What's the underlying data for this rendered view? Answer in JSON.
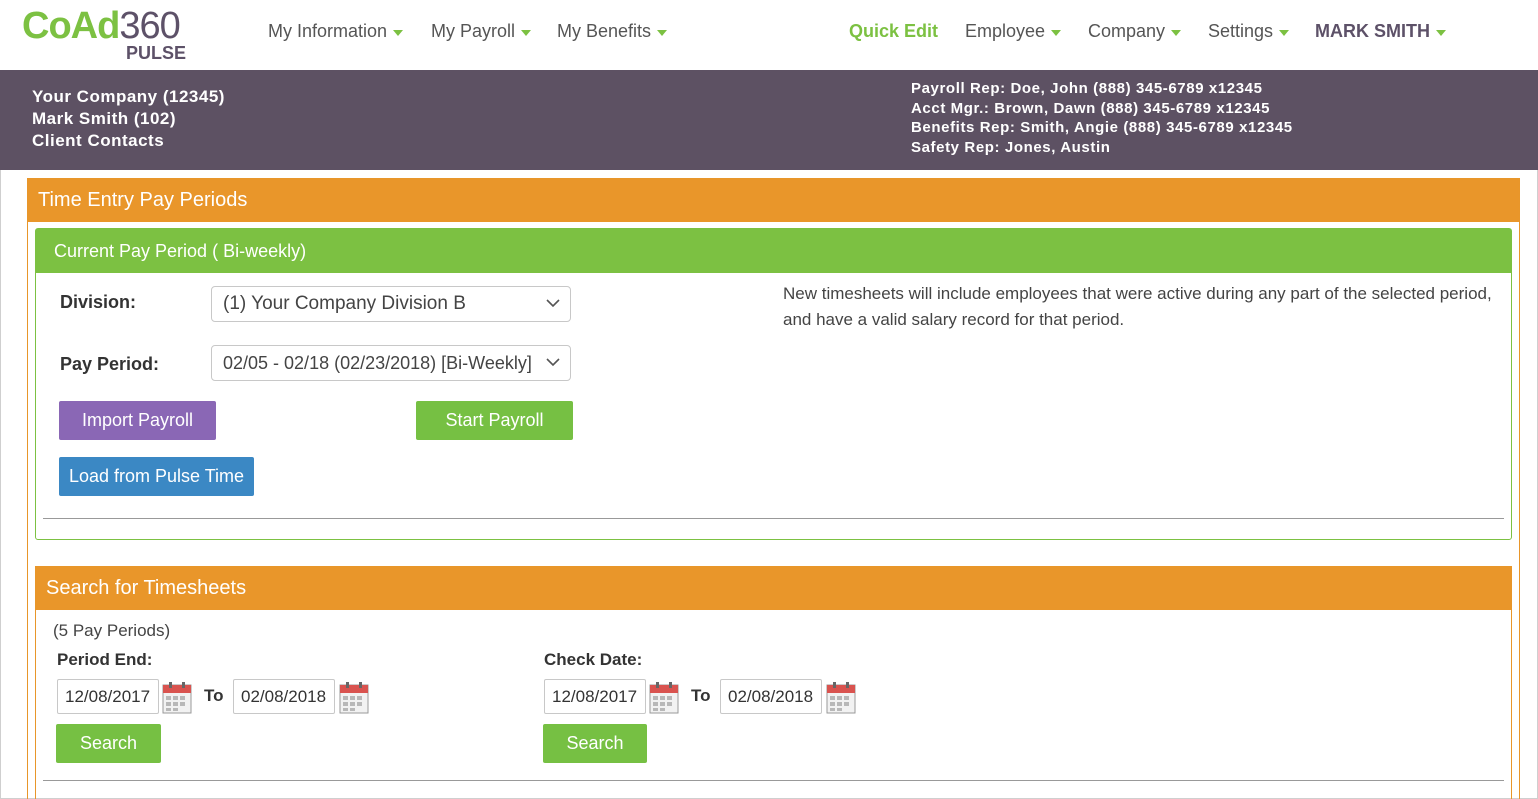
{
  "logo": {
    "brand_a": "CoAd",
    "brand_b": "360",
    "sub": "PULSE"
  },
  "nav": {
    "left": [
      {
        "label": "My Information"
      },
      {
        "label": "My Payroll"
      },
      {
        "label": "My Benefits"
      }
    ],
    "quick_edit": "Quick Edit",
    "right": [
      {
        "label": "Employee"
      },
      {
        "label": "Company"
      },
      {
        "label": "Settings"
      }
    ],
    "user": "MARK SMITH",
    "accent_color": "#7cc142"
  },
  "header": {
    "company": "Your Company (12345)",
    "user": "Mark Smith (102)",
    "contacts": "Client Contacts",
    "reps": [
      "Payroll Rep: Doe, John (888) 345-6789 x12345",
      "Acct Mgr.: Brown, Dawn (888) 345-6789 x12345",
      "Benefits Rep: Smith, Angie (888) 345-6789 x12345",
      "Safety Rep: Jones, Austin"
    ],
    "bg_color": "#5d5163"
  },
  "time_entry": {
    "title": "Time Entry Pay Periods",
    "current": {
      "title": "Current Pay Period ( Bi-weekly)",
      "division_label": "Division:",
      "division_value": "(1) Your Company Division B",
      "pay_period_label": "Pay Period:",
      "pay_period_value": "02/05 - 02/18 (02/23/2018) [Bi-Weekly]",
      "import_btn": "Import Payroll",
      "start_btn": "Start Payroll",
      "load_btn": "Load from Pulse Time",
      "info": "New timesheets will include employees that were active during any part of the selected period, and have a valid salary record for that period."
    }
  },
  "search": {
    "title": "Search for Timesheets",
    "count": "(5 Pay Periods)",
    "period_end_label": "Period End:",
    "period_end_from": "12/08/2017",
    "to_label": "To",
    "period_end_to": "02/08/2018",
    "check_date_label": "Check Date:",
    "check_date_from": "12/08/2017",
    "check_date_to": "02/08/2018",
    "search_btn": "Search"
  }
}
